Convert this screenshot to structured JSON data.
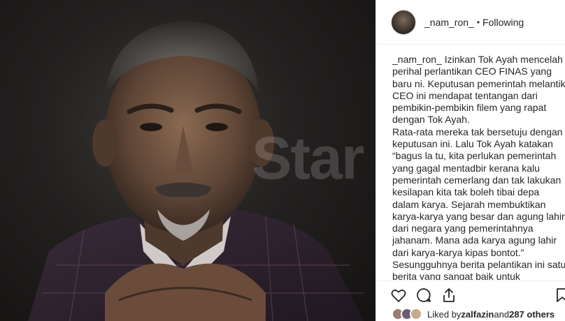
{
  "post": {
    "watermark": "Star"
  },
  "header": {
    "username": "_nam_ron_",
    "separator": "•",
    "follow_status": "Following"
  },
  "caption": {
    "username": "_nam_ron_",
    "p1": " Izinkan Tok Ayah mencelah perihal perlantikan CEO FINAS yang baru ni. Keputusan pemerintah melantik CEO ini mendapat tentangan dari pembikin-pembikin filem yang rapat dengan Tok Ayah.",
    "p2": "Rata-rata mereka tak bersetuju dengan keputusan ini. Lalu Tok Ayah katakan “bagus la tu, kita perlukan pemerintah yang gagal mentadbir kerana kalu pemerintah cemerlang dan tak lakukan kesilapan kita tak boleh tibai depa dalam karya. Sejarah membuktikan karya-karya yang besar dan agung lahir dari negara yang pemerintahnya jahanam. Mana ada karya agung lahir dari karya-karya kipas bontot.” Sesungguhnya berita pelantikan ini satu berita yang sangat baik untuk mengembalikan karya-karya filem ke wadah perjuangan sebenar. Baru lah Tok Ayah boleh balun pemerintah dalam karya."
  },
  "actions": {
    "like_icon": "heart-icon",
    "comment_icon": "comment-icon",
    "share_icon": "share-icon",
    "save_icon": "bookmark-icon"
  },
  "likes": {
    "prefix": "Liked by ",
    "user": "zalfazin",
    "middle": " and ",
    "others": "287 others"
  }
}
